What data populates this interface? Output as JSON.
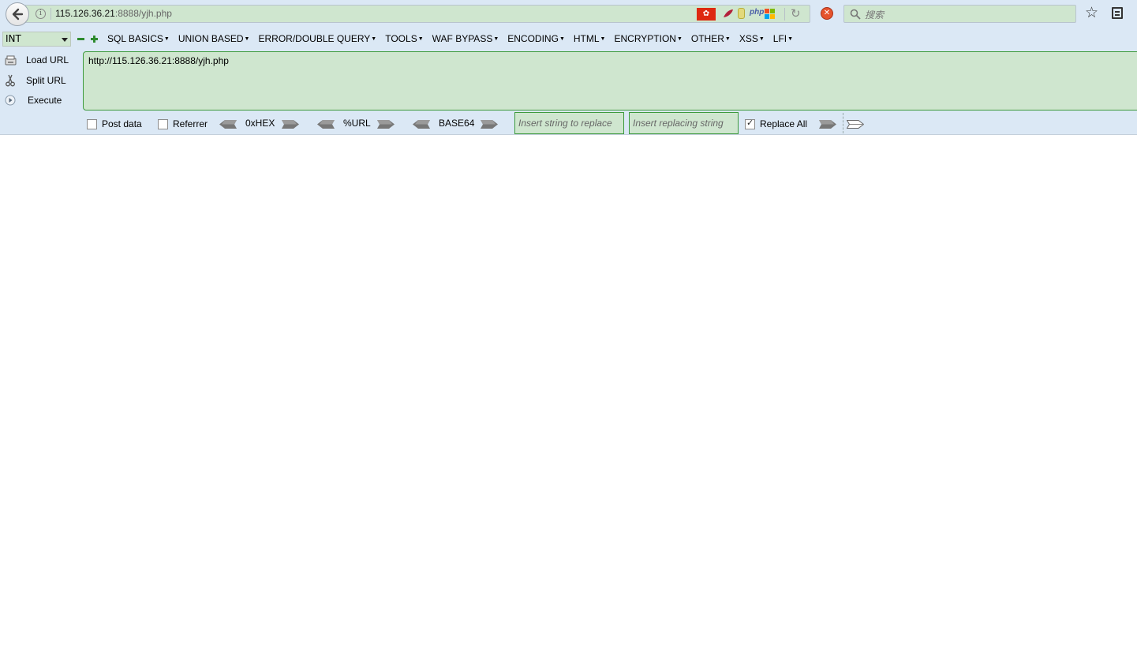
{
  "navbar": {
    "url_host": "115.126.36.21",
    "url_path": ":8888/yjh.php",
    "search_placeholder": "搜索",
    "php_badge": "php",
    "win_colors": [
      "#f25022",
      "#7fba00",
      "#00a4ef",
      "#ffb900"
    ]
  },
  "hackbar": {
    "int_select": "INT",
    "menu": [
      {
        "label": "SQL BASICS"
      },
      {
        "label": "UNION BASED"
      },
      {
        "label": "ERROR/DOUBLE QUERY"
      },
      {
        "label": "TOOLS"
      },
      {
        "label": "WAF BYPASS"
      },
      {
        "label": "ENCODING"
      },
      {
        "label": "HTML"
      },
      {
        "label": "ENCRYPTION"
      },
      {
        "label": "OTHER"
      },
      {
        "label": "XSS"
      },
      {
        "label": "LFI"
      }
    ],
    "side": {
      "load_url": "Load URL",
      "split_url": "Split URL",
      "execute": "Execute"
    },
    "url_value": "http://115.126.36.21:8888/yjh.php",
    "options": {
      "post_data": "Post data",
      "referrer": "Referrer",
      "hex": "0xHEX",
      "url_enc": "%URL",
      "base64": "BASE64",
      "replace_placeholder": "Insert string to replace",
      "replacing_placeholder": "Insert replacing string",
      "replace_all": "Replace All",
      "replace_all_checked": true,
      "post_data_checked": false,
      "referrer_checked": false
    },
    "accent_color": "#3d9a3d",
    "field_color": "#cfe6cf"
  }
}
